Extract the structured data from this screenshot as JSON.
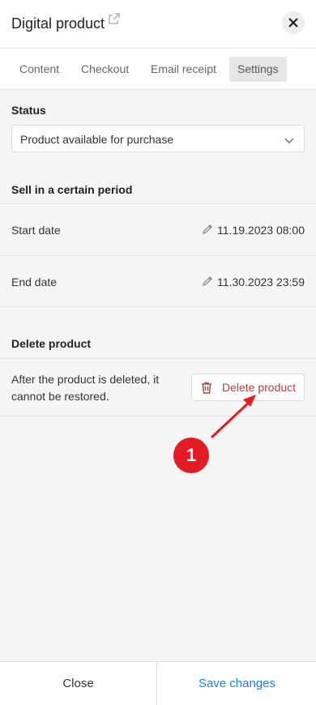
{
  "header": {
    "title": "Digital product",
    "external_icon": "external-link-icon",
    "close_icon": "close-icon"
  },
  "tabs": [
    {
      "label": "Content",
      "active": false
    },
    {
      "label": "Checkout",
      "active": false
    },
    {
      "label": "Email receipt",
      "active": false
    },
    {
      "label": "Settings",
      "active": true
    }
  ],
  "status": {
    "title": "Status",
    "selected": "Product available for purchase"
  },
  "period": {
    "title": "Sell in a certain period",
    "rows": [
      {
        "label": "Start date",
        "value": "11.19.2023 08:00"
      },
      {
        "label": "End date",
        "value": "11.30.2023 23:59"
      }
    ]
  },
  "delete": {
    "title": "Delete product",
    "description": "After the product is deleted, it cannot be restored.",
    "button_label": "Delete product"
  },
  "annotation": {
    "badge_number": "1",
    "color": "#e31b23"
  },
  "footer": {
    "close_label": "Close",
    "save_label": "Save changes"
  },
  "colors": {
    "accent": "#1a7fd4",
    "danger": "#a94444"
  }
}
